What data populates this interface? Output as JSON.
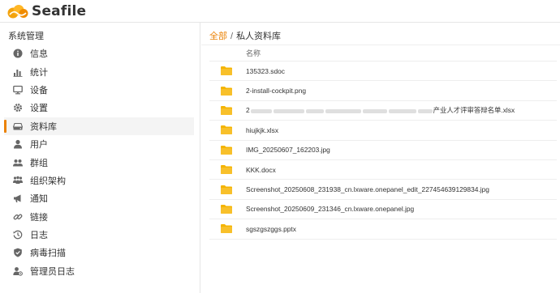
{
  "app": {
    "name": "Seafile"
  },
  "sidebar": {
    "title": "系统管理",
    "items": [
      {
        "label": "信息",
        "icon": "info-icon"
      },
      {
        "label": "统计",
        "icon": "stats-icon"
      },
      {
        "label": "设备",
        "icon": "desktop-icon"
      },
      {
        "label": "设置",
        "icon": "gear-icon"
      },
      {
        "label": "资料库",
        "icon": "drive-icon",
        "active": true
      },
      {
        "label": "用户",
        "icon": "user-icon"
      },
      {
        "label": "群组",
        "icon": "group-icon"
      },
      {
        "label": "组织架构",
        "icon": "org-icon"
      },
      {
        "label": "通知",
        "icon": "megaphone-icon"
      },
      {
        "label": "链接",
        "icon": "link-icon"
      },
      {
        "label": "日志",
        "icon": "history-icon"
      },
      {
        "label": "病毒扫描",
        "icon": "shield-icon"
      },
      {
        "label": "管理员日志",
        "icon": "admin-log-icon"
      }
    ]
  },
  "breadcrumb": {
    "root": "全部",
    "separator": "/",
    "current": "私人资料库"
  },
  "table": {
    "header_name": "名称",
    "rows": [
      {
        "name": "135323.sdoc"
      },
      {
        "name": "2-install-cockpit.png"
      },
      {
        "name_prefix": "2",
        "name_suffix": "产业人才评审答辩名单.xlsx"
      },
      {
        "name": "hiujkjk.xlsx"
      },
      {
        "name": "IMG_20250607_162203.jpg"
      },
      {
        "name": "KKK.docx"
      },
      {
        "name": "Screenshot_20250608_231938_cn.lxware.onepanel_edit_227454639129834.jpg"
      },
      {
        "name": "Screenshot_20250609_231346_cn.lxware.onepanel.jpg"
      },
      {
        "name": "sgszgszggs.pptx"
      }
    ]
  },
  "colors": {
    "accent": "#eb8205",
    "folder": "#f4b400"
  }
}
